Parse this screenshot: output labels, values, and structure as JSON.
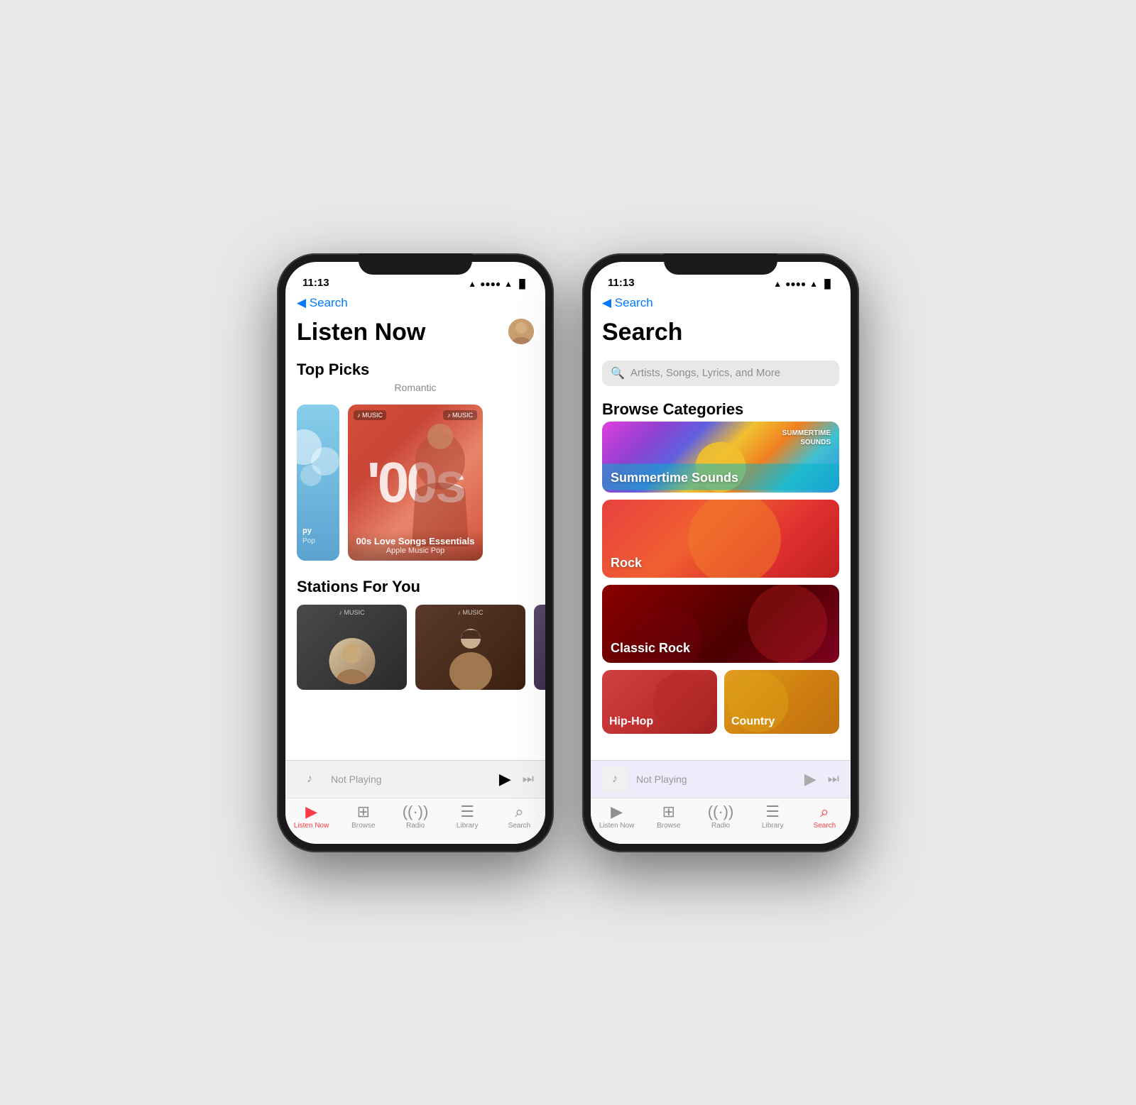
{
  "phone1": {
    "status": {
      "time": "11:13",
      "location_icon": "▶",
      "wifi": "wifi",
      "battery": "battery"
    },
    "back_label": "◀ Search",
    "page_title": "Listen Now",
    "top_picks": {
      "label": "Top Picks",
      "sublabel": "Romantic",
      "card1": {
        "type": "sky",
        "label": "py",
        "sublabel": "Pop"
      },
      "card2": {
        "type": "coral",
        "title": "00s Love Songs Essentials",
        "subtitle": "Apple Music Pop",
        "badge": "MUSIC"
      }
    },
    "stations": {
      "label": "Stations For You"
    },
    "mini_player": {
      "text": "Not Playing"
    },
    "tabs": [
      {
        "icon": "▶",
        "label": "Listen Now",
        "active": true
      },
      {
        "icon": "⊞",
        "label": "Browse",
        "active": false
      },
      {
        "icon": "◎",
        "label": "Radio",
        "active": false
      },
      {
        "icon": "☰",
        "label": "Library",
        "active": false
      },
      {
        "icon": "⌕",
        "label": "Search",
        "active": false
      }
    ]
  },
  "phone2": {
    "status": {
      "time": "11:13"
    },
    "back_label": "◀ Search",
    "page_title": "Search",
    "search_placeholder": "Artists, Songs, Lyrics, and More",
    "browse_categories": {
      "label": "Browse Categories",
      "items": [
        {
          "name": "Summertime Sounds",
          "type": "summertime",
          "badge": "SUMMERTIME\nSOUNDS"
        },
        {
          "name": "Rock",
          "type": "rock"
        },
        {
          "name": "Classic Rock",
          "type": "classic-rock"
        },
        {
          "name": "Hip-Hop",
          "type": "hiphop"
        },
        {
          "name": "Country",
          "type": "country"
        }
      ]
    },
    "mini_player": {
      "text": "Not Playing"
    },
    "tabs": [
      {
        "icon": "▶",
        "label": "Listen Now",
        "active": false
      },
      {
        "icon": "⊞",
        "label": "Browse",
        "active": false
      },
      {
        "icon": "◎",
        "label": "Radio",
        "active": false
      },
      {
        "icon": "☰",
        "label": "Library",
        "active": false
      },
      {
        "icon": "⌕",
        "label": "Search",
        "active": true
      }
    ]
  }
}
